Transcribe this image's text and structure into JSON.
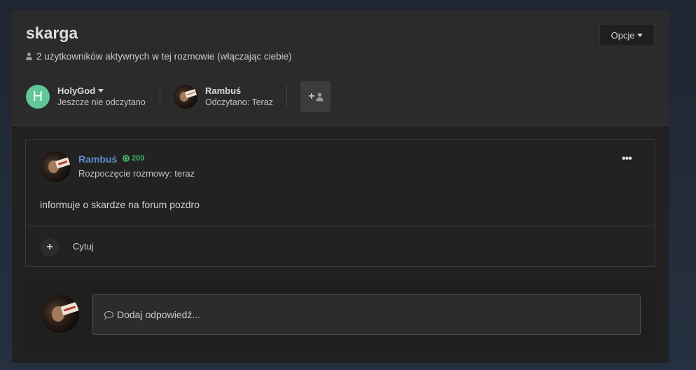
{
  "conversation": {
    "title": "skarga",
    "active_users": "2 użytkowników aktywnych w tej rozmowie (włączając ciebie)",
    "options_label": "Opcje"
  },
  "participants": [
    {
      "name": "HolyGod",
      "status": "Jeszcze nie odczytano",
      "avatar_letter": "H",
      "avatar_color": "#5fc79a"
    },
    {
      "name": "Rambuś",
      "status": "Odczytano: Teraz"
    }
  ],
  "post": {
    "author": "Rambuś",
    "reputation": "209",
    "meta": "Rozpoczęcie rozmowy: teraz",
    "body": "informuje o skardze na forum pozdro",
    "more_label": "•••",
    "quote_label": "Cytuj",
    "author_color": "#5e8bc8",
    "reputation_color": "#45b06a"
  },
  "reply": {
    "placeholder": "Dodaj odpowiedź..."
  }
}
